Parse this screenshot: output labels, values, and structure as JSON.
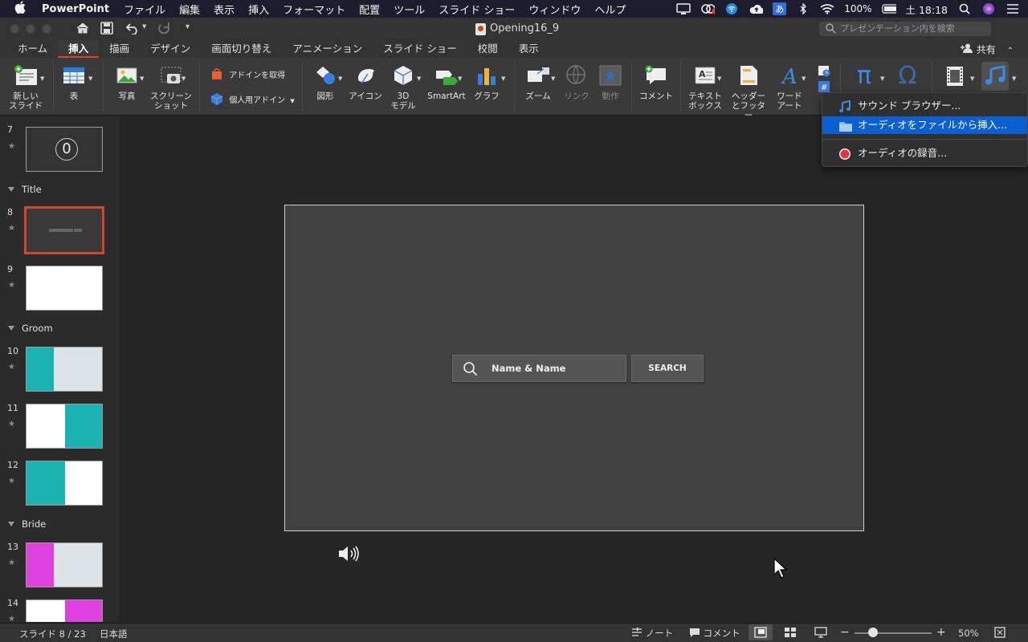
{
  "menubar": {
    "app_name": "PowerPoint",
    "items": [
      "ファイル",
      "編集",
      "表示",
      "挿入",
      "フォーマット",
      "配置",
      "ツール",
      "スライド ショー",
      "ウィンドウ",
      "ヘルプ"
    ],
    "ime": "あ",
    "battery": "100%",
    "clock": "土 18:18"
  },
  "window": {
    "title": "Opening16_9",
    "search_placeholder": "プレゼンテーション内を検索"
  },
  "tabs": [
    "ホーム",
    "挿入",
    "描画",
    "デザイン",
    "画面切り替え",
    "アニメーション",
    "スライド ショー",
    "校閲",
    "表示"
  ],
  "active_tab": "挿入",
  "share_label": "共有",
  "ribbon": {
    "new_slide": [
      "新しい",
      "スライド"
    ],
    "table": "表",
    "photo": "写真",
    "screenshot": [
      "スクリーン",
      "ショット"
    ],
    "get_addins": "アドインを取得",
    "my_addins": "個人用アドイン",
    "shapes": "図形",
    "icons": "アイコン",
    "model3d": [
      "3D",
      "モデル"
    ],
    "smartart": "SmartArt",
    "chart": "グラフ",
    "zoom": "ズーム",
    "link": "リンク",
    "action": "動作",
    "comment": "コメント",
    "textbox": [
      "テキスト",
      "ボックス"
    ],
    "header_footer": [
      "ヘッダー",
      "とフッター"
    ],
    "wordart": [
      "ワード",
      "アート"
    ],
    "omega": "Ω",
    "pi": "π"
  },
  "slides_panel": {
    "sections": [
      "Title",
      "Groom",
      "Bride"
    ],
    "numbers": [
      "7",
      "8",
      "9",
      "10",
      "11",
      "12",
      "13",
      "14"
    ],
    "thumb7_text": "0"
  },
  "slide": {
    "search_text": "Name & Name",
    "button_label": "SEARCH"
  },
  "audio_menu": {
    "items": [
      "サウンド ブラウザー...",
      "オーディオをファイルから挿入...",
      "オーディオの録音..."
    ],
    "highlighted_index": 1
  },
  "statusbar": {
    "slide_counter": "スライド 8 / 23",
    "language": "日本語",
    "notes": "ノート",
    "comments": "コメント",
    "zoom": "50%"
  },
  "colors": {
    "accent": "#d24726",
    "highlight": "#0a5fd1",
    "teal": "#1bb2b2",
    "magenta": "#e040e0"
  }
}
